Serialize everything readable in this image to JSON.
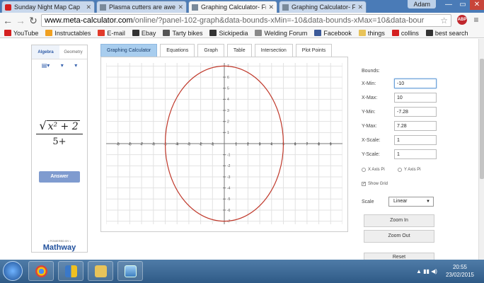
{
  "browser": {
    "tabs": [
      {
        "title": "Sunday Night Map Cap",
        "favicon_color": "#d42020"
      },
      {
        "title": "Plasma cutters are aweso",
        "favicon_color": "#7a8a9a"
      },
      {
        "title": "Graphing Calculator- Free",
        "favicon_color": "#7a8a9a"
      },
      {
        "title": "Graphing Calculator- Free",
        "favicon_color": "#7a8a9a"
      }
    ],
    "user": "Adam",
    "url_host": "www.meta-calculator.com",
    "url_path": "/online/?panel-102-graph&data-bounds-xMin=-10&data-bounds-xMax=10&data-bour",
    "abp_label": "ABP",
    "bookmarks": [
      {
        "label": "YouTube",
        "color": "#d42020"
      },
      {
        "label": "Instructables",
        "color": "#f0a020"
      },
      {
        "label": "E-mail",
        "color": "#e23a2a"
      },
      {
        "label": "Ebay",
        "color": "#333333"
      },
      {
        "label": "Tarty bikes",
        "color": "#555555"
      },
      {
        "label": "Sickipedia",
        "color": "#333333"
      },
      {
        "label": "Welding Forum",
        "color": "#888888"
      },
      {
        "label": "Facebook",
        "color": "#3b5998"
      },
      {
        "label": "things",
        "color": "#e8c35a"
      },
      {
        "label": "collins",
        "color": "#d42020"
      },
      {
        "label": "best search",
        "color": "#333333"
      }
    ]
  },
  "left_panel": {
    "tabs": [
      "Algebra",
      "Geometry"
    ],
    "tools": [
      "▤▾",
      "▾",
      "▾"
    ],
    "expression": {
      "radicand": "x² + 2",
      "denominator": "5+"
    },
    "answer_label": "Answer",
    "powered_by": "• POWERED BY •",
    "brand": "Mathway"
  },
  "main_tabs": [
    "Graphing Calculator",
    "Equations",
    "Graph",
    "Table",
    "Intersection",
    "Plot Points"
  ],
  "right_panel": {
    "bounds_label": "Bounds:",
    "fields": [
      {
        "label": "X-Min:",
        "value": "-10"
      },
      {
        "label": "X-Max:",
        "value": "10"
      },
      {
        "label": "Y-Min:",
        "value": "-7.28"
      },
      {
        "label": "Y-Max:",
        "value": "7.28"
      },
      {
        "label": "X-Scale:",
        "value": "1"
      },
      {
        "label": "Y-Scale:",
        "value": "1"
      }
    ],
    "x_axis_pi": "X Axis Pi",
    "y_axis_pi": "Y Axis Pi",
    "show_grid": "Show Grid",
    "scale_label": "Scale",
    "scale_value": "Linear",
    "zoom_in": "Zoom In",
    "zoom_out": "Zoom Out",
    "reset": "Reset"
  },
  "chart_data": {
    "type": "line",
    "title": "",
    "xlabel": "",
    "ylabel": "",
    "xlim": [
      -10,
      10
    ],
    "ylim": [
      -7.28,
      7.28
    ],
    "grid": true,
    "x_ticks": [
      -9,
      -8,
      -7,
      -6,
      -5,
      -4,
      -3,
      -2,
      -1,
      1,
      2,
      3,
      4,
      5,
      6,
      7,
      8,
      9
    ],
    "y_ticks": [
      -7,
      -6,
      -5,
      -4,
      -3,
      -2,
      -1,
      1,
      2,
      3,
      4,
      5,
      6,
      7
    ],
    "series": [
      {
        "shape": "ellipse",
        "center": [
          0,
          0
        ],
        "semi_axis_x": 5,
        "semi_axis_y": 7,
        "color": "#c0392b"
      }
    ]
  },
  "taskbar": {
    "time": "20:55",
    "date": "23/02/2015"
  }
}
